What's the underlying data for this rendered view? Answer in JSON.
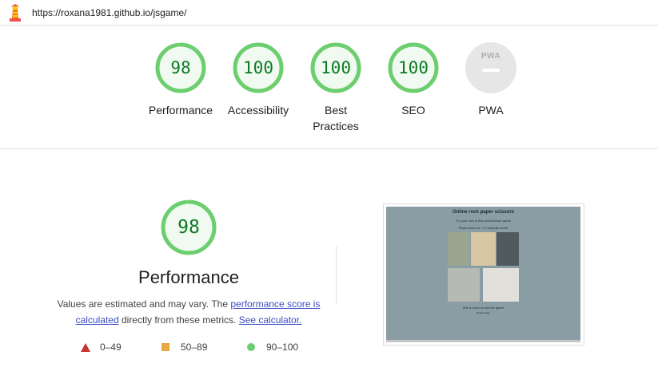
{
  "header": {
    "url": "https://roxana1981.github.io/jsgame/"
  },
  "categories": [
    {
      "id": "performance",
      "score": "98",
      "score_value": 0.98,
      "label": "Performance"
    },
    {
      "id": "accessibility",
      "score": "100",
      "score_value": 1.0,
      "label": "Accessibility"
    },
    {
      "id": "best-practices",
      "score": "100",
      "score_value": 1.0,
      "label": "Best Practices"
    },
    {
      "id": "seo",
      "score": "100",
      "score_value": 1.0,
      "label": "SEO"
    },
    {
      "id": "pwa",
      "badge": "PWA",
      "label": "PWA"
    }
  ],
  "performance": {
    "score": "98",
    "score_value": 0.98,
    "title": "Performance",
    "desc_prefix": "Values are estimated and may vary. The ",
    "link_score": "performance score is calculated",
    "desc_middle": " directly from these metrics. ",
    "link_calc": "See calculator."
  },
  "legend": [
    {
      "range": "0–49",
      "icon": "triangle-icon",
      "color": "#cc3333"
    },
    {
      "range": "50–89",
      "icon": "square-icon",
      "color": "#e8a93d"
    },
    {
      "range": "90–100",
      "icon": "circle-icon",
      "color": "#6cce6e"
    }
  ],
  "screenshot": {
    "title": "Online rock paper scissors",
    "subtitle": "Try your luck in this world known game",
    "score_line": "Player score is - 0 Computer score",
    "footer": "Win a round to win the game",
    "small": "Reload page"
  },
  "colors": {
    "pass_ring": "#6cce6e",
    "pass_text": "#0c7a24",
    "pass_fill": "#f0faf0",
    "pwa_gray": "#e6e6e6"
  }
}
